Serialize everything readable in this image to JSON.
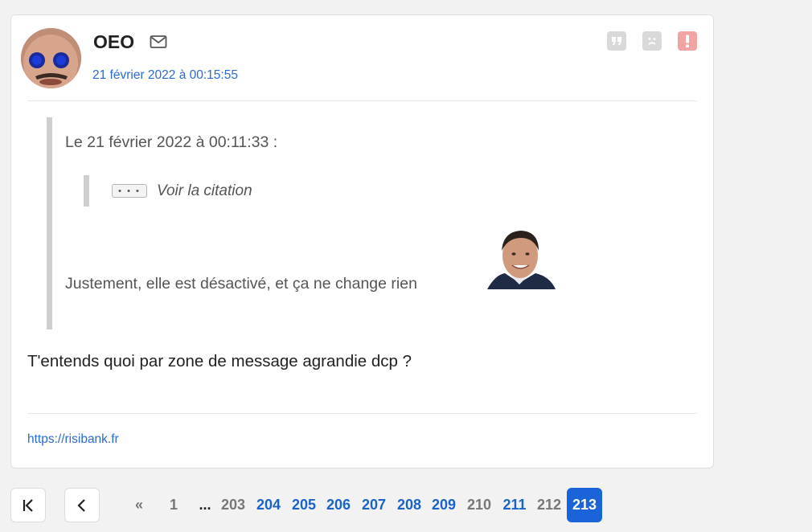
{
  "post": {
    "username": "OEO",
    "date": "21 février 2022 à 00:15:55",
    "quote_header": "Le 21 février 2022 à 00:11:33 :",
    "nested_quote_dots": "• • •",
    "nested_quote_label": "Voir la citation",
    "quoted_text": "Justement, elle est désactivé, et ça ne change rien",
    "reply_text": "T'entends quoi par zone de message agrandie dcp ?",
    "signature_link": "https://risibank.fr",
    "action_icons": [
      "quote-icon",
      "sad-face-icon",
      "alert-icon"
    ],
    "colors": {
      "link": "#2a6bd1",
      "report": "#f2a3a3",
      "active_page": "#1a63d9"
    }
  },
  "pagination": {
    "prev_symbol": "«",
    "pages": [
      {
        "label": "1",
        "style": "grey"
      },
      {
        "label": "...",
        "style": "dots"
      },
      {
        "label": "203",
        "style": "grey"
      },
      {
        "label": "204",
        "style": "blue"
      },
      {
        "label": "205",
        "style": "blue"
      },
      {
        "label": "206",
        "style": "blue"
      },
      {
        "label": "207",
        "style": "blue"
      },
      {
        "label": "208",
        "style": "blue"
      },
      {
        "label": "209",
        "style": "blue"
      },
      {
        "label": "210",
        "style": "grey"
      },
      {
        "label": "211",
        "style": "blue"
      },
      {
        "label": "212",
        "style": "grey"
      },
      {
        "label": "213",
        "style": "current"
      }
    ]
  }
}
